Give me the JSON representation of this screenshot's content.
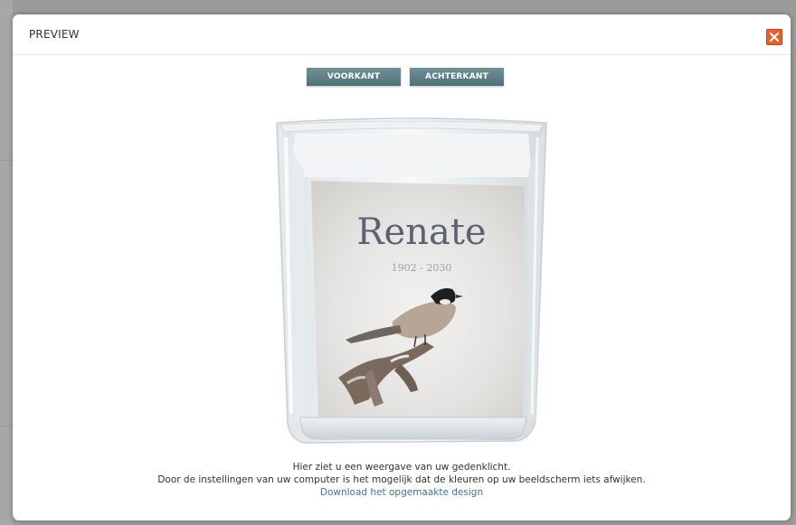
{
  "modal": {
    "title": "PREVIEW"
  },
  "tabs": [
    {
      "label": "VOORKANT"
    },
    {
      "label": "ACHTERKANT"
    }
  ],
  "preview": {
    "name": "Renate",
    "years": "1902 - 2030"
  },
  "info": {
    "line1": "Hier ziet u een weergave van uw gedenklicht.",
    "line2": "Door de instellingen van uw computer is het mogelijk dat de kleuren op uw beeldscherm iets afwijken.",
    "download_link": "Download het opgemaakte design"
  },
  "colors": {
    "tab_bg": "#56787e",
    "close_bg": "#e8602c",
    "link": "#3b7a86"
  },
  "icons": {
    "close": "close-icon"
  }
}
